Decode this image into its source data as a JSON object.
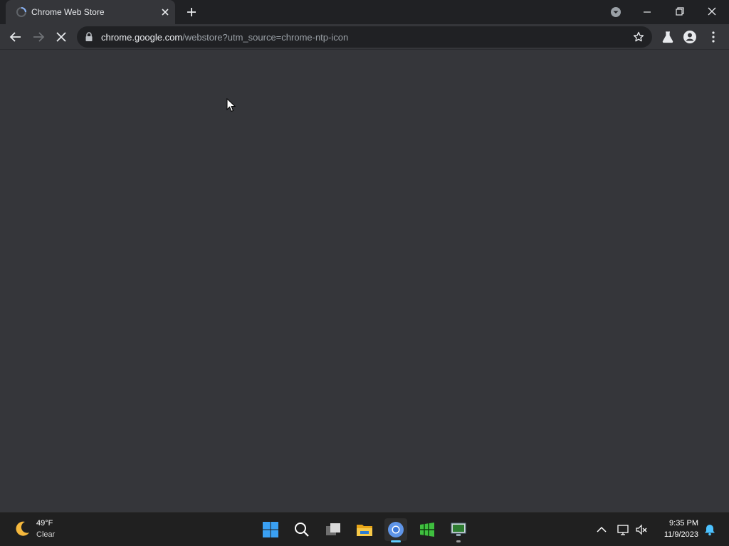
{
  "browser": {
    "tab": {
      "title": "Chrome Web Store"
    },
    "omnibox": {
      "host": "chrome.google.com",
      "path": "/webstore?utm_source=chrome-ntp-icon"
    }
  },
  "taskbar": {
    "weather": {
      "temp": "49°F",
      "condition": "Clear"
    },
    "clock": {
      "time": "9:35 PM",
      "date": "11/9/2023"
    }
  },
  "colors": {
    "tab_bg": "#35363a",
    "frame_bg": "#202124",
    "content_bg": "#35363a",
    "taskbar_bg": "#202020",
    "accent": "#60cdff"
  }
}
